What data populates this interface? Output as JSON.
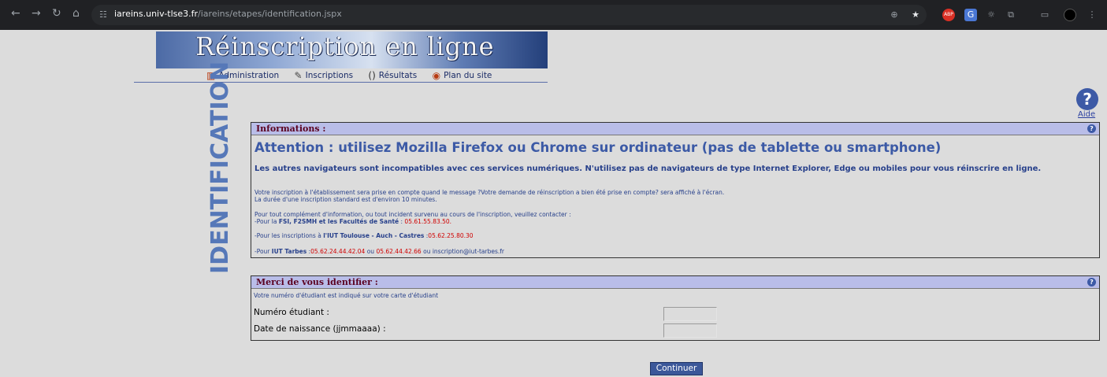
{
  "browser": {
    "url_host": "iareins.univ-tlse3.fr",
    "url_path": "/iareins/etapes/identification.jspx",
    "icons": [
      "back-icon",
      "forward-icon",
      "reload-icon",
      "home-icon",
      "site-settings-icon",
      "zoom-icon",
      "bookmark-star-icon",
      "adblock-icon",
      "translate-icon",
      "extensions-icon",
      "cast-icon",
      "profile-icon",
      "menu-icon"
    ]
  },
  "banner": {
    "title": "Réinscription en ligne"
  },
  "menu": {
    "items": [
      {
        "label": "Administration",
        "icon": "building-icon"
      },
      {
        "label": "Inscriptions",
        "icon": "pen-icon"
      },
      {
        "label": "Résultats",
        "icon": "parentheses-icon"
      },
      {
        "label": "Plan du site",
        "icon": "sitemap-icon"
      }
    ]
  },
  "side_label": "IDENTIFICATION",
  "aide": {
    "icon": "help-icon",
    "label": "Aide"
  },
  "informations": {
    "header": "Informations :",
    "attention": "Attention : utilisez Mozilla Firefox ou Chrome sur ordinateur (pas de tablette ou smartphone)",
    "subtitle": "Les autres navigateurs sont incompatibles avec ces services numériques. N'utilisez pas de navigateurs de type Internet Explorer, Edge ou mobiles pour vous réinscrire en ligne.",
    "line1": "Votre inscription à l'établissement sera prise en compte quand le message ?Votre demande de réinscription a bien été prise en compte? sera affiché à l'écran.",
    "line2": "La durée d'une inscription standard est d'environ 10 minutes.",
    "line3": "Pour tout complément d'information, ou tout incident survenu au cours de l'inscription, veuillez contacter :",
    "fsi_prefix": "-Pour la ",
    "fsi_bold": "FSI, F2SMH et les Facultés de Santé",
    "fsi_sep": " : ",
    "fsi_phone": "05.61.55.83.50.",
    "iut_prefix": "-Pour les inscriptions à ",
    "iut_bold": "l'IUT Toulouse - Auch - Castres",
    "iut_sep": " :",
    "iut_phone": "05.62.25.80.30",
    "tarbes_prefix": "-Pour ",
    "tarbes_bold": "IUT Tarbes",
    "tarbes_sep": " :",
    "tarbes_phone1": "05.62.24.44.42.04",
    "tarbes_or": " ou ",
    "tarbes_phone2": "05.62.44.42.66",
    "tarbes_or2": " ou ",
    "tarbes_email": "inscription@iut-tarbes.fr"
  },
  "identify": {
    "header": "Merci de vous identifier :",
    "hint": "Votre numéro d'étudiant est indiqué sur votre carte d'étudiant",
    "student_label": "Numéro étudiant :",
    "student_value": "",
    "birth_label": "Date de naissance (jjmmaaaa) :",
    "birth_value": ""
  },
  "continue_label": "Continuer",
  "colors": {
    "panel_header": "#b9bde8",
    "header_text": "#5a0020",
    "accent_blue": "#3c5aa6",
    "phone_red": "#d00000",
    "button": "#3b5799"
  }
}
